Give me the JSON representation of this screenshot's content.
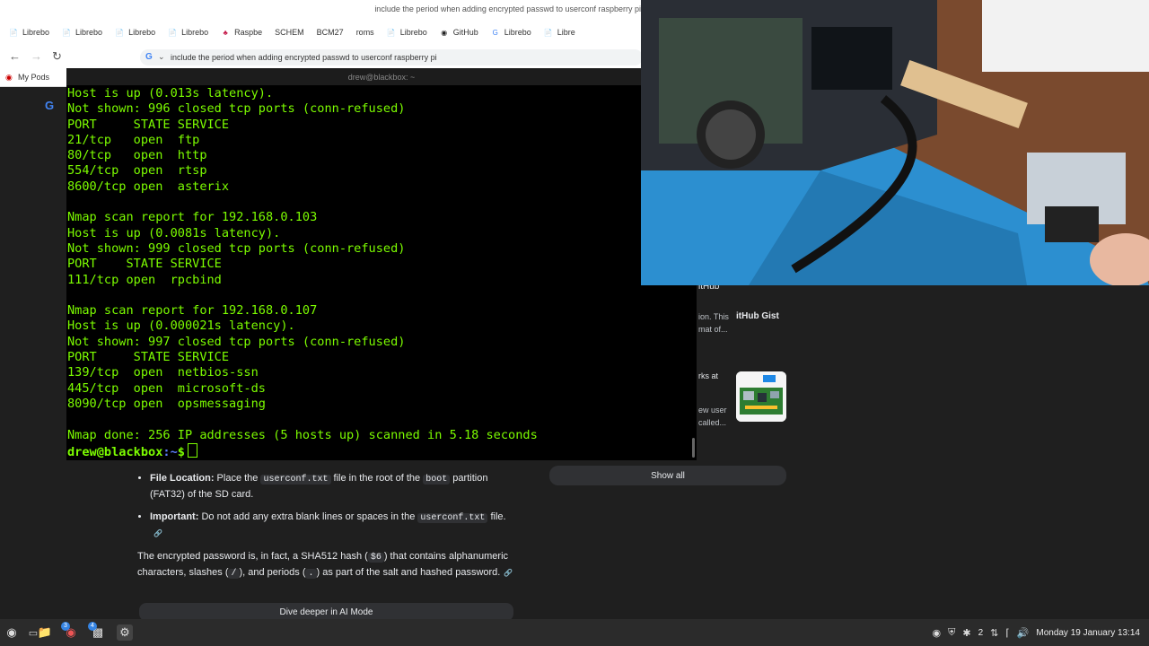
{
  "browser": {
    "window_title": "include the period when adding encrypted passwd to userconf raspberry pi",
    "tabs": [
      {
        "icon": "document-icon",
        "label": "Librebo"
      },
      {
        "icon": "document-icon",
        "label": "Librebo"
      },
      {
        "icon": "document-icon",
        "label": "Librebo"
      },
      {
        "icon": "document-icon",
        "label": "Librebo"
      },
      {
        "icon": "raspberry-icon",
        "label": "Raspbe"
      },
      {
        "icon": "",
        "label": "SCHEM"
      },
      {
        "icon": "",
        "label": "BCM27"
      },
      {
        "icon": "",
        "label": "roms"
      },
      {
        "icon": "document-icon",
        "label": "Librebo"
      },
      {
        "icon": "github-icon",
        "label": "GitHub"
      },
      {
        "icon": "google-icon",
        "label": "Librebo"
      },
      {
        "icon": "document-icon",
        "label": "Libre"
      }
    ],
    "omnibox_query": "include the period when adding encrypted passwd to userconf raspberry pi",
    "bookmark": "My Pods"
  },
  "terminal": {
    "title": "drew@blackbox: ~",
    "lines": [
      "Host is up (0.013s latency).",
      "Not shown: 996 closed tcp ports (conn-refused)",
      "PORT     STATE SERVICE",
      "21/tcp   open  ftp",
      "80/tcp   open  http",
      "554/tcp  open  rtsp",
      "8600/tcp open  asterix",
      "",
      "Nmap scan report for 192.168.0.103",
      "Host is up (0.0081s latency).",
      "Not shown: 999 closed tcp ports (conn-refused)",
      "PORT    STATE SERVICE",
      "111/tcp open  rpcbind",
      "",
      "Nmap scan report for 192.168.0.107",
      "Host is up (0.000021s latency).",
      "Not shown: 997 closed tcp ports (conn-refused)",
      "PORT     STATE SERVICE",
      "139/tcp  open  netbios-ssn",
      "445/tcp  open  microsoft-ds",
      "8090/tcp open  opsmessaging",
      "",
      "Nmap done: 256 IP addresses (5 hosts up) scanned in 5.18 seconds"
    ],
    "prompt_user": "drew@blackbox",
    "prompt_path": ":~",
    "prompt_symbol": "$"
  },
  "ai_overview": {
    "bullet1_label": "File Location:",
    "bullet1_text_a": " Place the ",
    "bullet1_code": "userconf.txt",
    "bullet1_text_b": " file in the root of the ",
    "bullet1_code2": "boot",
    "bullet1_text_c": " partition (FAT32) of the SD card.",
    "bullet2_label": "Important:",
    "bullet2_text_a": " Do not add any extra blank lines or spaces in the ",
    "bullet2_code": "userconf.txt",
    "bullet2_text_b": " file.",
    "para_a": "The encrypted password is, in fact, a SHA512 hash (",
    "para_code1": "$6",
    "para_b": ") that contains alphanumeric characters, slashes (",
    "para_code2": "/",
    "para_c": "), and periods (",
    "para_code3": ".",
    "para_d": ") as part of the salt and hashed password.",
    "dive_deeper": "Dive deeper in AI Mode"
  },
  "sources": {
    "title_fragment": "itHub",
    "snippet1": "ion. This mat of...",
    "gist_label": "itHub Gist",
    "snippet2": "rks at",
    "snippet3": "ew user called...",
    "show_all": "Show all"
  },
  "taskbar": {
    "clock": "Monday 19 January 13:14",
    "tray_count": "2",
    "badge1": "3",
    "badge2": "4"
  },
  "colors": {
    "terminal_green": "#7CFC00",
    "prompt_path_blue": "#5c7cfa"
  }
}
